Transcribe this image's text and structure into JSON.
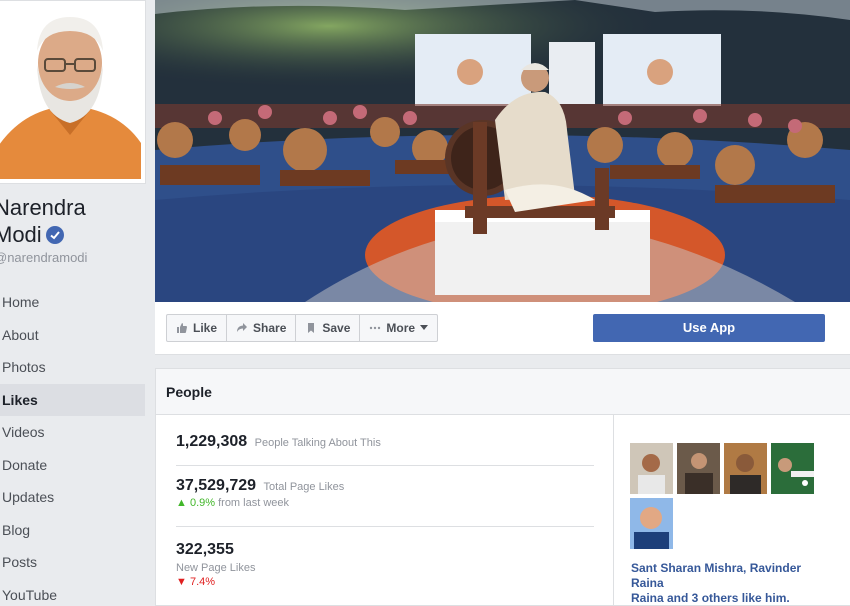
{
  "page": {
    "name_line1": "Narendra",
    "name_line2": "Modi",
    "handle": "@narendramodi"
  },
  "nav": {
    "items": [
      {
        "label": "Home"
      },
      {
        "label": "About"
      },
      {
        "label": "Photos"
      },
      {
        "label": "Likes",
        "active": true
      },
      {
        "label": "Videos"
      },
      {
        "label": "Donate"
      },
      {
        "label": "Updates"
      },
      {
        "label": "Blog"
      },
      {
        "label": "Posts"
      },
      {
        "label": "YouTube"
      }
    ]
  },
  "actions": {
    "like": "Like",
    "share": "Share",
    "save": "Save",
    "more": "More",
    "use_app": "Use App"
  },
  "people": {
    "title": "People",
    "talking": {
      "value": "1,229,308",
      "label": "People Talking About This"
    },
    "total_likes": {
      "value": "37,529,729",
      "label": "Total Page Likes",
      "change": "0.9%",
      "change_label": "from last week"
    },
    "new_likes": {
      "value": "322,355",
      "label": "New Page Likes",
      "change": "7.4%"
    },
    "friends": {
      "names": "Sant Sharan Mishra, Ravinder Raina",
      "rest": "Raina and 3 others like him."
    }
  },
  "colors": {
    "brand_blue": "#4267b2",
    "link_blue": "#365899",
    "up_green": "#42b72a",
    "down_red": "#e02020"
  }
}
